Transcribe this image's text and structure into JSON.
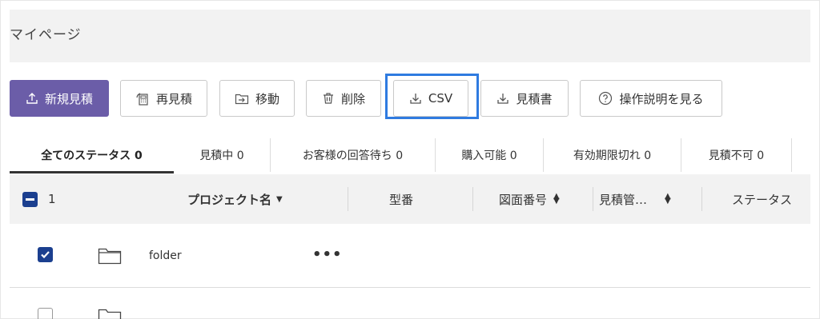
{
  "page": {
    "title": "マイページ"
  },
  "toolbar": {
    "new_quote": {
      "label": "新規見積",
      "icon": "upload-icon"
    },
    "requote": {
      "label": "再見積",
      "icon": "calculator-icon"
    },
    "move": {
      "label": "移動",
      "icon": "move-folder-icon"
    },
    "delete": {
      "label": "削除",
      "icon": "trash-icon"
    },
    "csv": {
      "label": "CSV",
      "icon": "download-icon",
      "highlighted": true
    },
    "quote_doc": {
      "label": "見積書",
      "icon": "download-icon"
    },
    "help": {
      "label": "操作説明を見る",
      "icon": "question-circle-icon"
    }
  },
  "tabs": [
    {
      "label": "全てのステータス 0",
      "active": true
    },
    {
      "label": "見積中 0"
    },
    {
      "label": "お客様の回答待ち 0"
    },
    {
      "label": "購入可能 0"
    },
    {
      "label": "有効期限切れ 0"
    },
    {
      "label": "見積不可 0"
    }
  ],
  "table": {
    "selected_count": "1",
    "columns": {
      "project_name": "プロジェクト名",
      "model_number": "型番",
      "drawing_number": "図面番号",
      "quote_mgmt": "見積管…",
      "status": "ステータス"
    },
    "rows": [
      {
        "name": "folder",
        "checked": true,
        "type": "folder",
        "menu": "•••"
      }
    ]
  },
  "colors": {
    "primary": "#6b5da8",
    "highlight": "#2f7be0",
    "checkbox": "#1b3f8f"
  }
}
